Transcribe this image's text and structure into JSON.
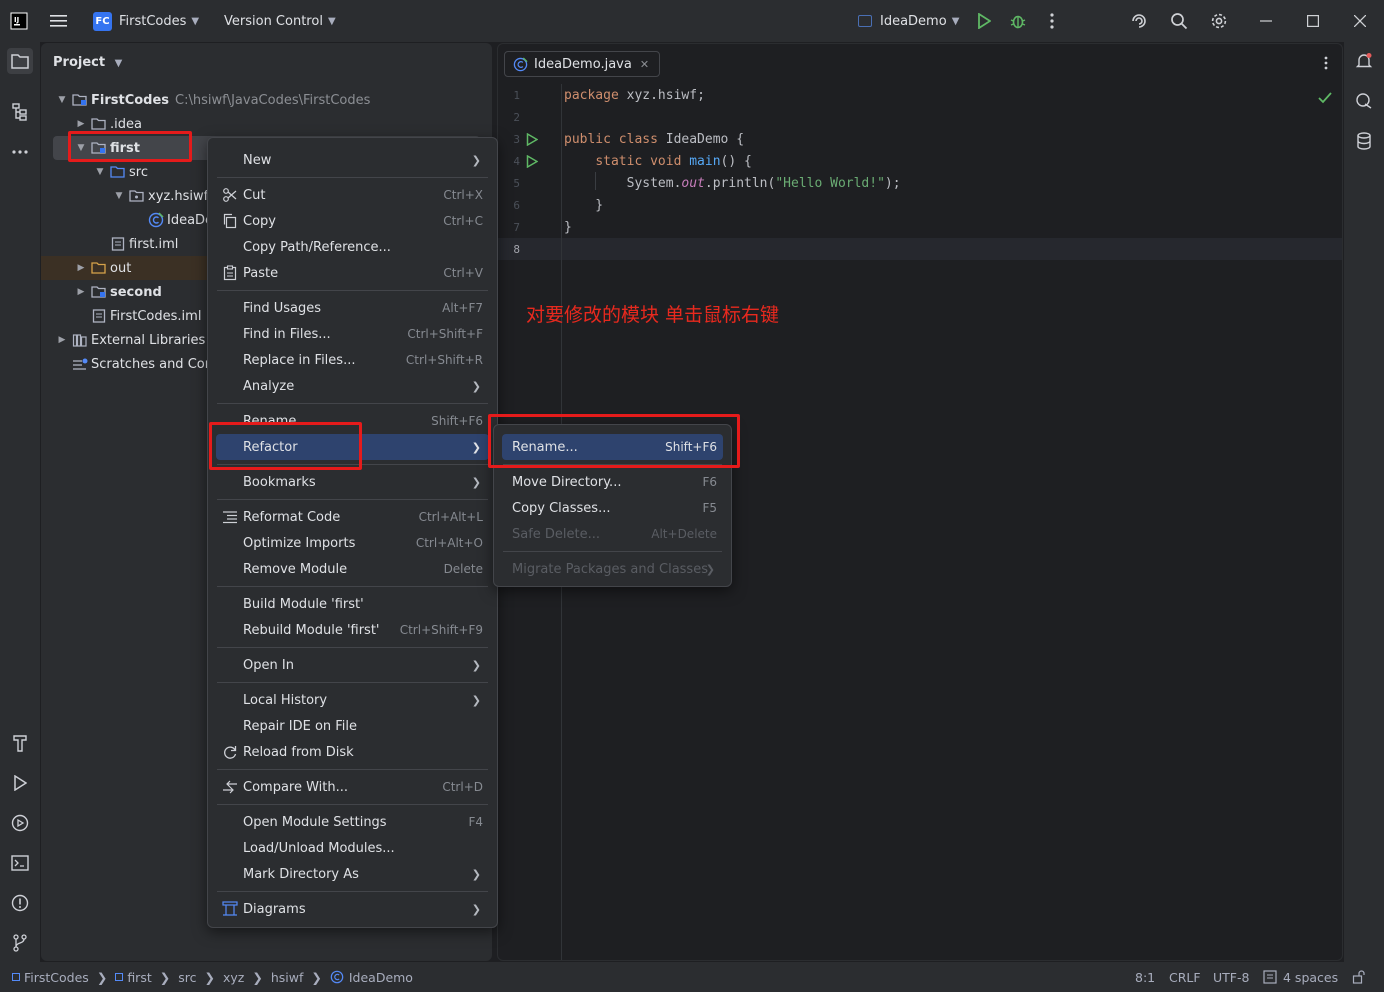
{
  "titlebar": {
    "project_badge": "FC",
    "project_name": "FirstCodes",
    "vcs_label": "Version Control",
    "run_config": "IdeaDemo"
  },
  "project_panel": {
    "title": "Project",
    "tree": [
      {
        "label": "FirstCodes",
        "path": "C:\\hsiwf\\JavaCodes\\FirstCodes"
      },
      {
        "label": ".idea"
      },
      {
        "label": "first"
      },
      {
        "label": "src"
      },
      {
        "label": "xyz.hsiwf"
      },
      {
        "label": "IdeaDe"
      },
      {
        "label": "first.iml"
      },
      {
        "label": "out"
      },
      {
        "label": "second"
      },
      {
        "label": "FirstCodes.iml"
      },
      {
        "label": "External Libraries"
      },
      {
        "label": "Scratches and Cons"
      }
    ]
  },
  "editor": {
    "tab_label": "IdeaDemo.java",
    "line_numbers": [
      "1",
      "2",
      "3",
      "4",
      "5",
      "6",
      "7",
      "8"
    ],
    "code": {
      "l1_kw": "package",
      "l1_rest": " xyz.hsiwf;",
      "l3_kw": "public class",
      "l3_rest": " IdeaDemo {",
      "l4_indent": "    ",
      "l4_kw": "static void",
      "l4_sp": " ",
      "l4_fn": "main",
      "l4_rest": "() {",
      "l5_a": "        System.",
      "l5_b": "out",
      "l5_c": ".println(",
      "l5_str": "\"Hello World!\"",
      "l5_d": ");",
      "l6": "    }",
      "l7": "}"
    },
    "annotation": "对要修改的模块 单击鼠标右键"
  },
  "context_menu": {
    "items": [
      {
        "label": "New",
        "shortcut": ""
      },
      {
        "label": "Cut",
        "shortcut": "Ctrl+X"
      },
      {
        "label": "Copy",
        "shortcut": "Ctrl+C"
      },
      {
        "label": "Copy Path/Reference...",
        "shortcut": ""
      },
      {
        "label": "Paste",
        "shortcut": "Ctrl+V"
      },
      {
        "label": "Find Usages",
        "shortcut": "Alt+F7"
      },
      {
        "label": "Find in Files...",
        "shortcut": "Ctrl+Shift+F"
      },
      {
        "label": "Replace in Files...",
        "shortcut": "Ctrl+Shift+R"
      },
      {
        "label": "Analyze",
        "shortcut": ""
      },
      {
        "label": "Rename...",
        "shortcut": "Shift+F6"
      },
      {
        "label": "Refactor",
        "shortcut": ""
      },
      {
        "label": "Bookmarks",
        "shortcut": ""
      },
      {
        "label": "Reformat Code",
        "shortcut": "Ctrl+Alt+L"
      },
      {
        "label": "Optimize Imports",
        "shortcut": "Ctrl+Alt+O"
      },
      {
        "label": "Remove Module",
        "shortcut": "Delete"
      },
      {
        "label": "Build Module 'first'",
        "shortcut": ""
      },
      {
        "label": "Rebuild Module 'first'",
        "shortcut": "Ctrl+Shift+F9"
      },
      {
        "label": "Open In",
        "shortcut": ""
      },
      {
        "label": "Local History",
        "shortcut": ""
      },
      {
        "label": "Repair IDE on File",
        "shortcut": ""
      },
      {
        "label": "Reload from Disk",
        "shortcut": ""
      },
      {
        "label": "Compare With...",
        "shortcut": "Ctrl+D"
      },
      {
        "label": "Open Module Settings",
        "shortcut": "F4"
      },
      {
        "label": "Load/Unload Modules...",
        "shortcut": ""
      },
      {
        "label": "Mark Directory As",
        "shortcut": ""
      },
      {
        "label": "Diagrams",
        "shortcut": ""
      }
    ]
  },
  "refactor_submenu": {
    "items": [
      {
        "label": "Rename...",
        "shortcut": "Shift+F6"
      },
      {
        "label": "Move Directory...",
        "shortcut": "F6"
      },
      {
        "label": "Copy Classes...",
        "shortcut": "F5"
      },
      {
        "label": "Safe Delete...",
        "shortcut": "Alt+Delete"
      },
      {
        "label": "Migrate Packages and Classes",
        "shortcut": ""
      }
    ]
  },
  "statusbar": {
    "breadcrumb": [
      "FirstCodes",
      "first",
      "src",
      "xyz",
      "hsiwf",
      "IdeaDemo"
    ],
    "position": "8:1",
    "line_sep": "CRLF",
    "encoding": "UTF-8",
    "indent": "4 spaces"
  },
  "colors": {
    "accent": "#3574f0",
    "selection": "#2e436e",
    "annotation_red": "#e51b1b",
    "run_green": "#5fb865"
  }
}
